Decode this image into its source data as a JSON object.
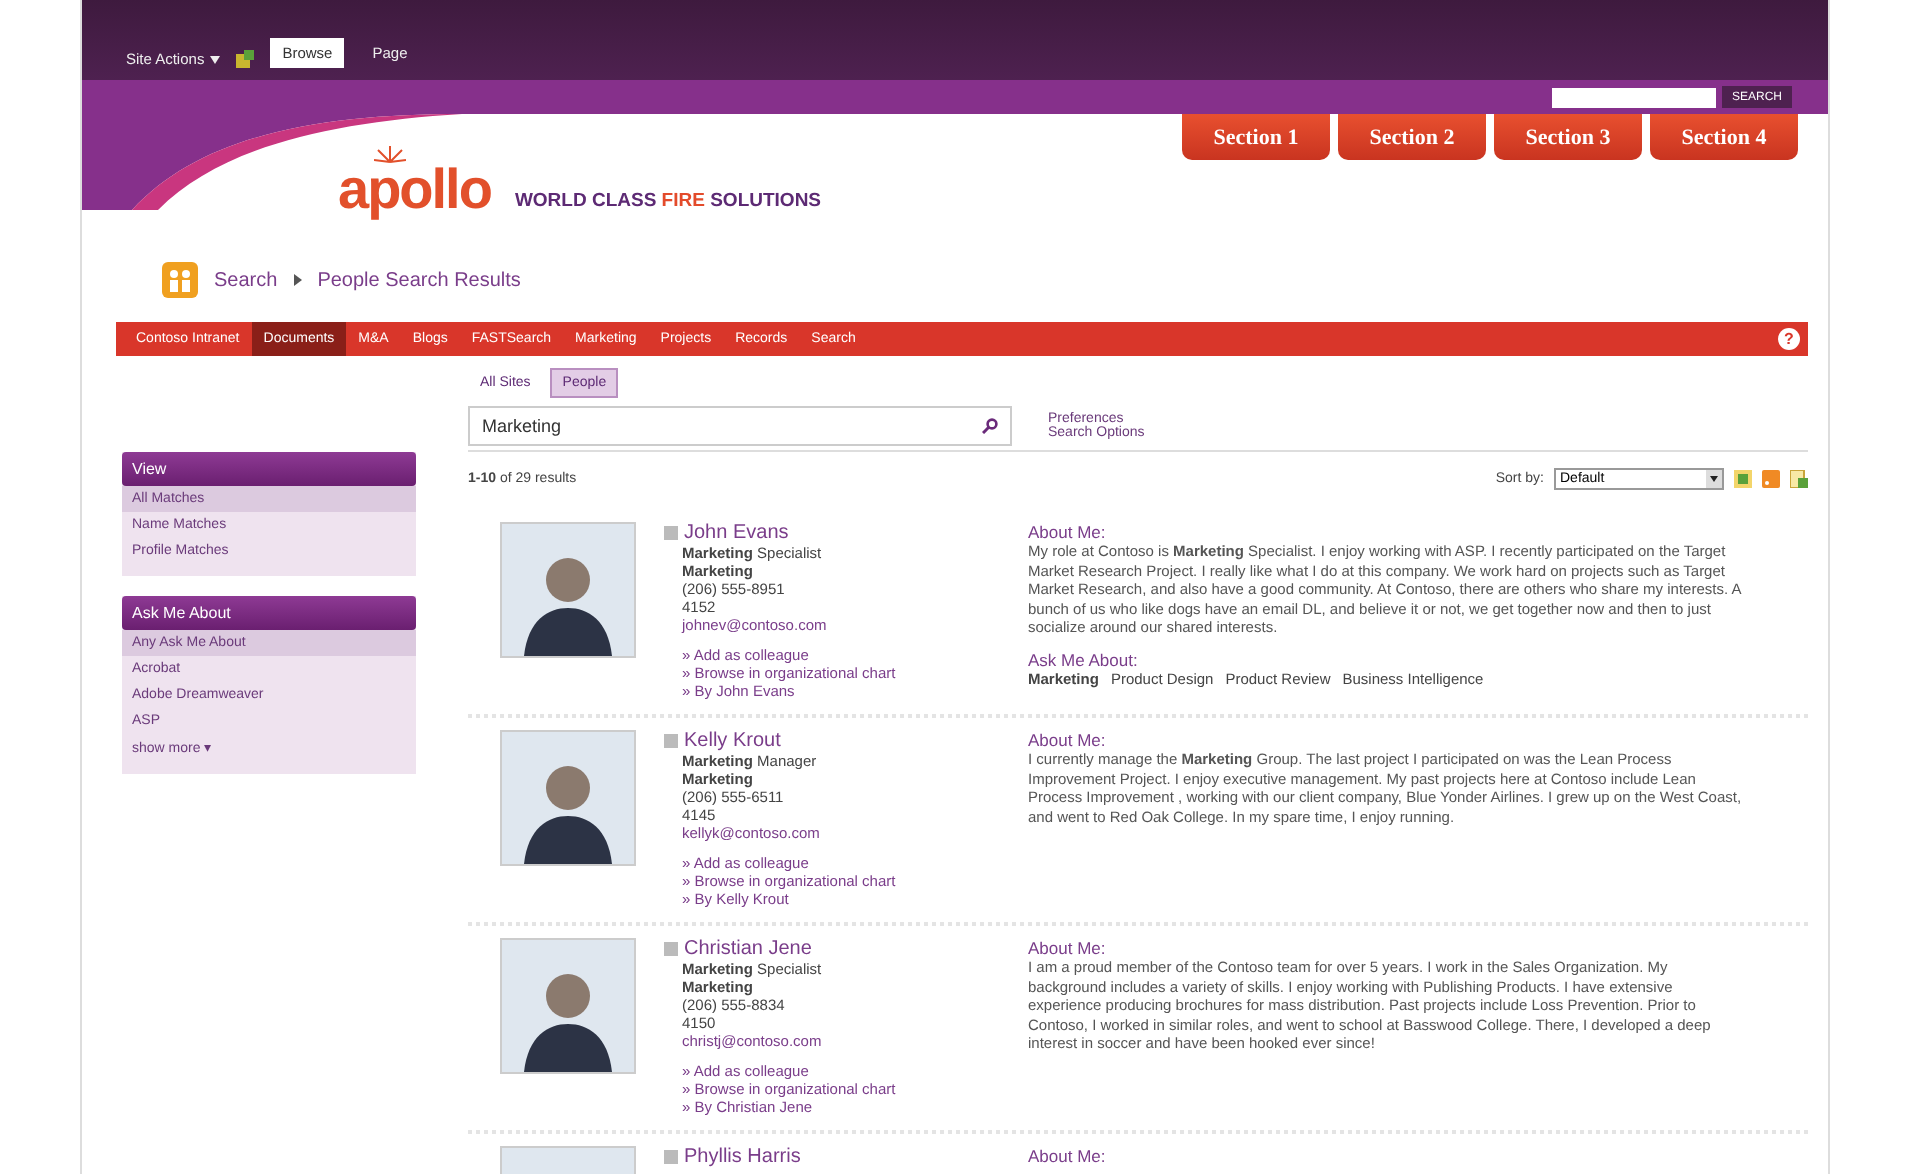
{
  "top_bar": {
    "site_actions": "Site Actions",
    "tabs": [
      {
        "label": "Browse",
        "selected": true
      },
      {
        "label": "Page",
        "selected": false
      }
    ]
  },
  "header_search": {
    "button": "SEARCH"
  },
  "logo": {
    "name": "apollo",
    "tagline": [
      {
        "text": "WORLD CLASS",
        "highlight": false
      },
      {
        "text": "FIRE",
        "highlight": true
      },
      {
        "text": "SOLUTIONS",
        "highlight": false
      }
    ]
  },
  "sections": [
    "Section 1",
    "Section 2",
    "Section 3",
    "Section 4"
  ],
  "breadcrumb": [
    "Search",
    "People Search Results"
  ],
  "nav": [
    {
      "label": "Contoso Intranet",
      "selected": false
    },
    {
      "label": "Documents",
      "selected": true
    },
    {
      "label": "M&A",
      "selected": false
    },
    {
      "label": "Blogs",
      "selected": false
    },
    {
      "label": "FASTSearch",
      "selected": false
    },
    {
      "label": "Marketing",
      "selected": false
    },
    {
      "label": "Projects",
      "selected": false
    },
    {
      "label": "Records",
      "selected": false
    },
    {
      "label": "Search",
      "selected": false
    }
  ],
  "help": "?",
  "scopes": [
    {
      "label": "All Sites",
      "selected": false
    },
    {
      "label": "People",
      "selected": true
    }
  ],
  "search": {
    "value": "Marketing"
  },
  "search_links": [
    "Preferences",
    "Search Options"
  ],
  "results_count": "**1-10** of 29 results",
  "sort": {
    "label": "Sort by:",
    "value": "Default"
  },
  "refiners": [
    {
      "title": "View",
      "items": [
        {
          "label": "All Matches",
          "selected": true
        },
        {
          "label": "Name Matches",
          "selected": false
        },
        {
          "label": "Profile Matches",
          "selected": false
        }
      ]
    },
    {
      "title": "Ask Me About",
      "items": [
        {
          "label": "Any Ask Me About",
          "selected": true
        },
        {
          "label": "Acrobat",
          "selected": false
        },
        {
          "label": "Adobe Dreamweaver",
          "selected": false
        },
        {
          "label": "ASP",
          "selected": false
        }
      ],
      "more": "show more ▾"
    }
  ],
  "people": [
    {
      "name": "John Evans",
      "title": "**Marketing** Specialist",
      "department": "Marketing",
      "phone": "(206) 555-8951",
      "extension": "4152",
      "email": "johnev@contoso.com",
      "links": [
        "» Add as colleague",
        "» Browse in organizational chart",
        "» By John Evans"
      ],
      "about_label": "About Me:",
      "about": "My role at Contoso is **Marketing** Specialist. I enjoy working with ASP. I recently participated on the Target Market Research Project. I really like what I do at this company. We work hard on projects such as Target Market Research, and also have a good community. At Contoso, there are others who share my interests. A bunch of us who like dogs have an email DL, and believe it or not, we get together now and then to just socialize around our shared interests.",
      "ask_label": "Ask Me About:",
      "ask_topics": [
        "**Marketing**",
        "Product Design",
        "Product Review",
        "Business Intelligence"
      ]
    },
    {
      "name": "Kelly Krout",
      "title": "**Marketing** Manager",
      "department": "Marketing",
      "phone": "(206) 555-6511",
      "extension": "4145",
      "email": "kellyk@contoso.com",
      "links": [
        "» Add as colleague",
        "» Browse in organizational chart",
        "» By Kelly Krout"
      ],
      "about_label": "About Me:",
      "about": "I currently manage the **Marketing** Group. The last project I participated on was the Lean Process Improvement Project. I enjoy executive management. My past projects here at Contoso include Lean Process Improvement , working with our client company, Blue Yonder Airlines. I grew up on the West Coast, and went to Red Oak College. In my spare time, I enjoy running."
    },
    {
      "name": "Christian Jene",
      "title": "**Marketing** Specialist",
      "department": "Marketing",
      "phone": "(206) 555-8834",
      "extension": "4150",
      "email": "christj@contoso.com",
      "links": [
        "» Add as colleague",
        "» Browse in organizational chart",
        "» By Christian Jene"
      ],
      "about_label": "About Me:",
      "about": "I am a proud member of the Contoso team for over 5 years. I work in the Sales Organization. My background includes a variety of skills. I enjoy working with Publishing Products. I have extensive experience producing brochures for mass distribution. Past projects include Loss Prevention. Prior to Contoso, I worked in similar roles, and went to school at Basswood College. There, I developed a deep interest in soccer and have been hooked ever since!"
    },
    {
      "name": "Phyllis Harris",
      "about_label": "About Me:"
    }
  ]
}
